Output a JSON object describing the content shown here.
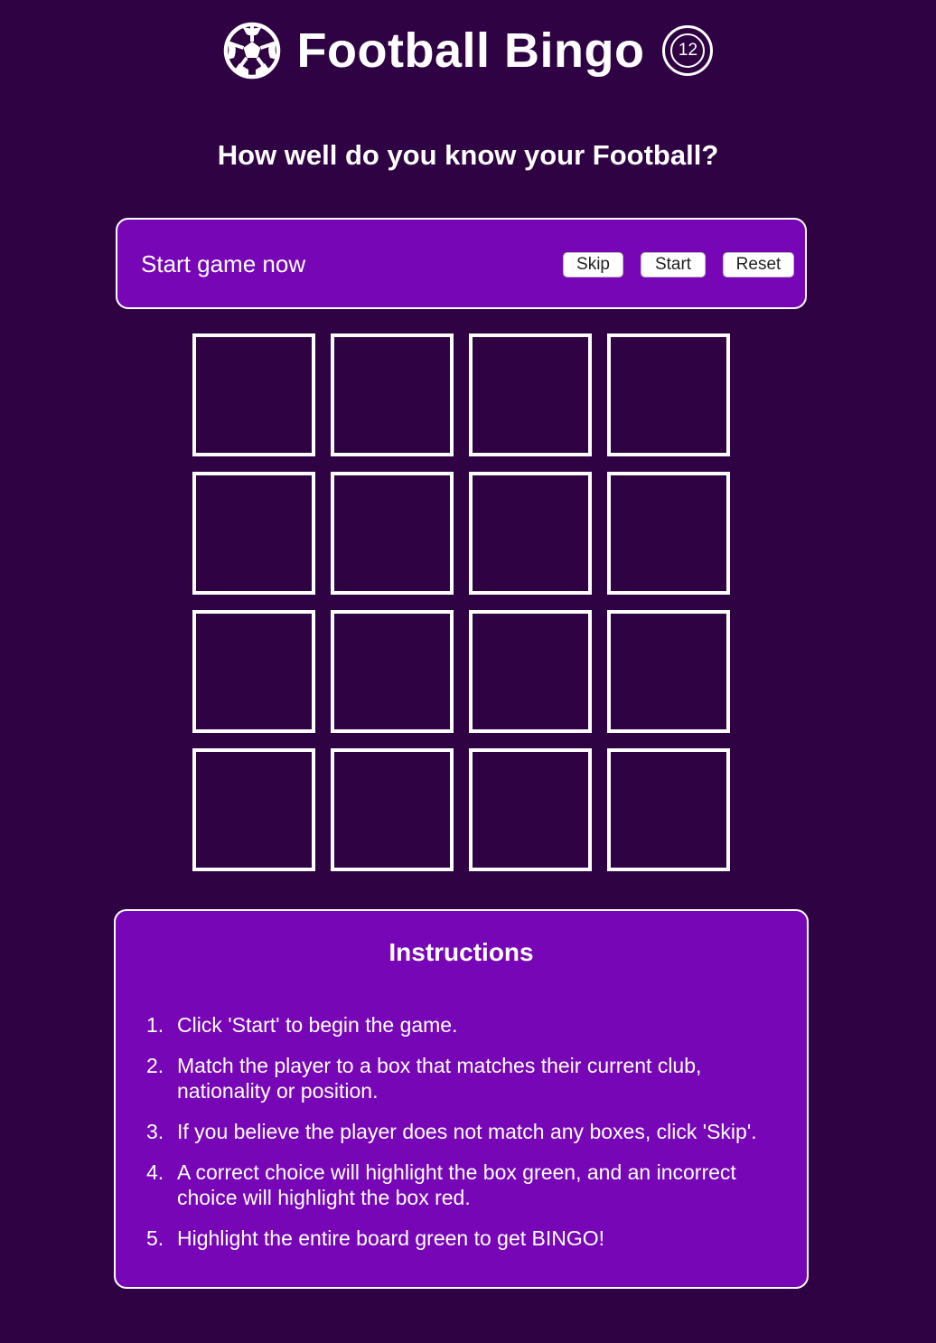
{
  "header": {
    "title": "Football Bingo",
    "count": "12",
    "logo_icon": "soccer-ball-icon"
  },
  "subtitle": "How well do you know your Football?",
  "controls": {
    "status": "Start game now",
    "skip_label": "Skip",
    "start_label": "Start",
    "reset_label": "Reset"
  },
  "board": {
    "rows": 4,
    "columns": 4,
    "cells": [
      "",
      "",
      "",
      "",
      "",
      "",
      "",
      "",
      "",
      "",
      "",
      "",
      "",
      "",
      "",
      ""
    ]
  },
  "instructions": {
    "title": "Instructions",
    "steps": [
      {
        "number": "1.",
        "text": "Click 'Start' to begin the game."
      },
      {
        "number": "2.",
        "text": "Match the player to a box that matches their current club, nationality or position."
      },
      {
        "number": "3.",
        "text": "If you believe the player does not match any boxes, click 'Skip'."
      },
      {
        "number": "4.",
        "text": "A correct choice will highlight the box green, and an incorrect choice will highlight the box red."
      },
      {
        "number": "5.",
        "text": "Highlight the entire board green to get BINGO!"
      }
    ]
  },
  "colors": {
    "background": "#2f0343",
    "panel": "#7706b7",
    "text": "#ffffff"
  }
}
